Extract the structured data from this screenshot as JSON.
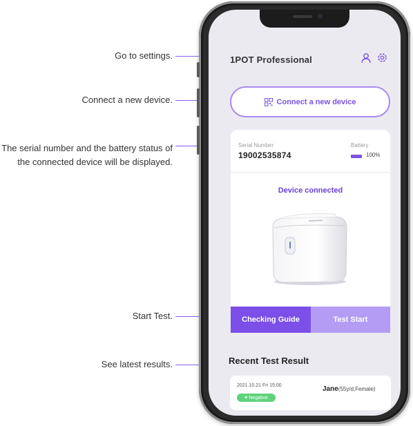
{
  "annotations": [
    {
      "text": "Go to settings."
    },
    {
      "text": "Connect a new device."
    },
    {
      "text": "The serial number and the battery status of the connected device will be displayed."
    },
    {
      "text": "Start Test."
    },
    {
      "text": "See latest results."
    }
  ],
  "app": {
    "title": "1POT Professional",
    "accent_color": "#7b52e3",
    "icons": [
      "user-icon",
      "gear-icon",
      "qr-icon"
    ]
  },
  "connect": {
    "label": "Connect a new device"
  },
  "device": {
    "serial_label": "Serial Number",
    "serial_number": "19002535874",
    "battery_label": "Battery",
    "battery_level": "100%",
    "status": "Device connected"
  },
  "actions": {
    "checking_guide": "Checking Guide",
    "test_start": "Test Start"
  },
  "recent": {
    "title": "Recent Test Result",
    "date": "2021.10.21 Fri 15:00",
    "badge": "Negative",
    "badge_color": "#5fd27e",
    "name": "Jane",
    "meta": "(55y/d,Female)"
  }
}
